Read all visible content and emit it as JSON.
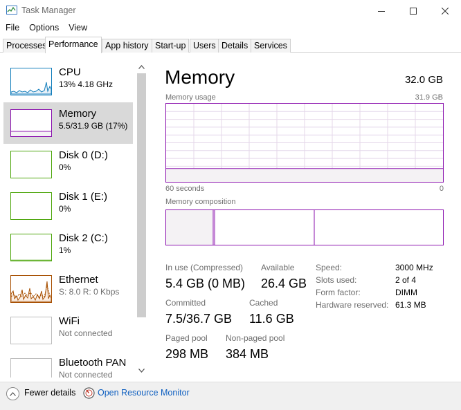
{
  "window": {
    "title": "Task Manager",
    "icons": {
      "app": "task-manager-icon",
      "minimize": "minimize-icon",
      "maximize": "maximize-icon",
      "close": "close-icon"
    }
  },
  "menu": [
    "File",
    "Options",
    "View"
  ],
  "tabs": [
    "Processes",
    "Performance",
    "App history",
    "Start-up",
    "Users",
    "Details",
    "Services"
  ],
  "active_tab": "Performance",
  "sidebar": {
    "items": [
      {
        "name": "CPU",
        "sub": "13%  4.18 GHz",
        "color": "#117dbb"
      },
      {
        "name": "Memory",
        "sub": "5.5/31.9 GB (17%)",
        "color": "#8b12ae"
      },
      {
        "name": "Disk 0 (D:)",
        "sub": "0%",
        "color": "#4da60c"
      },
      {
        "name": "Disk 1 (E:)",
        "sub": "0%",
        "color": "#4da60c"
      },
      {
        "name": "Disk 2 (C:)",
        "sub": "1%",
        "color": "#4da60c"
      },
      {
        "name": "Ethernet",
        "sub": "S: 8.0  R: 0 Kbps",
        "color": "#a74f01"
      },
      {
        "name": "WiFi",
        "sub": "Not connected",
        "color": "#bdbdbd"
      },
      {
        "name": "Bluetooth PAN",
        "sub": "Not connected",
        "color": "#bdbdbd"
      }
    ]
  },
  "main": {
    "title": "Memory",
    "total": "32.0 GB",
    "usage_label": "Memory usage",
    "usage_max": "31.9 GB",
    "time_left": "60 seconds",
    "time_right": "0",
    "composition_label": "Memory composition",
    "usage_level": 0.17,
    "composition": {
      "in_use": 0.17,
      "modified": 0.005,
      "standby": 0.36
    }
  },
  "stats": {
    "in_use_label": "In use (Compressed)",
    "in_use_value": "5.4 GB (0 MB)",
    "available_label": "Available",
    "available_value": "26.4 GB",
    "committed_label": "Committed",
    "committed_value": "7.5/36.7 GB",
    "cached_label": "Cached",
    "cached_value": "11.6 GB",
    "paged_label": "Paged pool",
    "paged_value": "298 MB",
    "nonpaged_label": "Non-paged pool",
    "nonpaged_value": "384 MB"
  },
  "details": [
    {
      "label": "Speed:",
      "value": "3000 MHz"
    },
    {
      "label": "Slots used:",
      "value": "2 of 4"
    },
    {
      "label": "Form factor:",
      "value": "DIMM"
    },
    {
      "label": "Hardware reserved:",
      "value": "61.3 MB"
    }
  ],
  "footer": {
    "fewer_details": "Fewer details",
    "open_resource_monitor": "Open Resource Monitor"
  },
  "colors": {
    "memory_accent": "#8b12ae",
    "memory_fill": "#f4f2f4",
    "grid": "#e4d7ea",
    "link": "#1060c0"
  }
}
